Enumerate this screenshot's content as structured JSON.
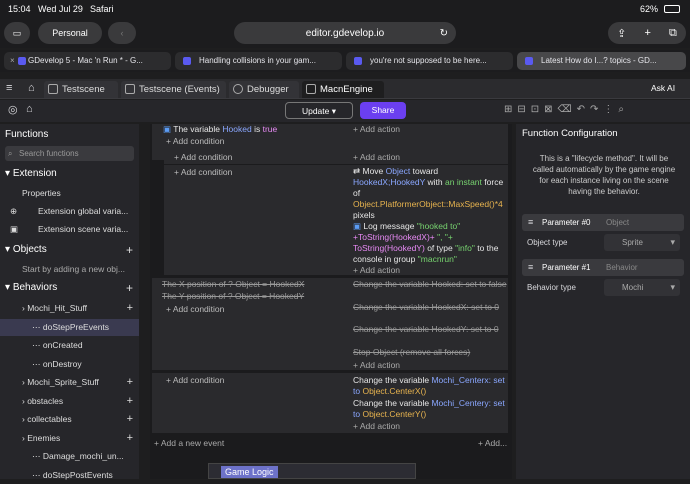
{
  "status": {
    "time": "15:04",
    "date": "Wed Jul 29",
    "app": "Safari",
    "battery": "62%"
  },
  "safari": {
    "profile": "Personal",
    "url": "editor.gdevelop.io"
  },
  "browser_tabs": [
    {
      "label": "GDevelop 5 - Mac 'n Run * - G...",
      "active": false
    },
    {
      "label": "Handling collisions in your gam...",
      "active": false
    },
    {
      "label": "you're not supposed to be here...",
      "active": false
    },
    {
      "label": "Latest How do I...? topics - GD...",
      "active": true
    }
  ],
  "app_tabs": [
    "Testscene",
    "Testscene (Events)",
    "Debugger",
    "MacnEngine"
  ],
  "toolbar": {
    "update": "Update",
    "share": "Share",
    "ask_ai": "Ask AI"
  },
  "sidebar": {
    "functions_title": "Functions",
    "search_placeholder": "Search functions",
    "extension_title": "Extension",
    "extension_items": [
      "Properties",
      "Extension global varia...",
      "Extension scene varia..."
    ],
    "objects_title": "Objects",
    "objects_hint": "Start by adding a new obj...",
    "behaviors_title": "Behaviors",
    "behaviors": [
      {
        "label": "Mochi_Hit_Stuff",
        "level": 0
      },
      {
        "label": "doStepPreEvents",
        "level": 1,
        "selected": true
      },
      {
        "label": "onCreated",
        "level": 1
      },
      {
        "label": "onDestroy",
        "level": 1
      },
      {
        "label": "Mochi_Sprite_Stuff",
        "level": 0
      },
      {
        "label": "obstacles",
        "level": 0
      },
      {
        "label": "collectables",
        "level": 0
      },
      {
        "label": "Enemies",
        "level": 0
      },
      {
        "label": "Damage_mochi_un...",
        "level": 1
      },
      {
        "label": "doStepPostEvents",
        "level": 1
      }
    ]
  },
  "events": {
    "add_condition": "Add condition",
    "add_action": "Add action",
    "add_new_event": "Add a new event",
    "add_more": "Add...",
    "cond_hooked": [
      "The variable",
      "Hooked",
      "is",
      "true"
    ],
    "disabled_cond1": "The X position of ? Object = HookedX",
    "disabled_cond2": "The Y position of ? Object = HookedY",
    "move_action": [
      "Move",
      "Object",
      "toward",
      "HookedX;HookedY",
      "with",
      "an instant",
      "force of",
      "Object.PlatformerObject::MaxSpeed()*4",
      "pixels"
    ],
    "log_action": [
      "Log message",
      "\"hooked to\"",
      "+ToString(HookedX)+",
      "\", \"+",
      "ToString(HookedY)",
      "of type",
      "\"info\"",
      "to the console in group",
      "\"macnrun\""
    ],
    "disabled_acts": [
      "Change the variable",
      "Hooked: set to false",
      "Change the variable",
      "HookedX: set to 0",
      "Change the variable",
      "HookedY: set to 0",
      "Stop",
      "Object",
      "(remove all forces)"
    ],
    "centerx": [
      "Change the variable",
      "Mochi_Centerx: set to",
      "Object.CenterX()"
    ],
    "centery": [
      "Change the variable",
      "Mochi_Centery: set to",
      "Object.CenterY()"
    ],
    "group_label": "Game Logic"
  },
  "rpanel": {
    "title": "Function Configuration",
    "desc": "This is a \"lifecycle method\". It will be called automatically by the game engine for each instance living on the scene having the behavior.",
    "param0": "Parameter #0",
    "param0_name": "Object",
    "object_type_label": "Object type",
    "object_type_value": "Sprite",
    "param1": "Parameter #1",
    "param1_name": "Behavior",
    "behavior_type_label": "Behavior type",
    "behavior_type_value": "Mochi"
  }
}
